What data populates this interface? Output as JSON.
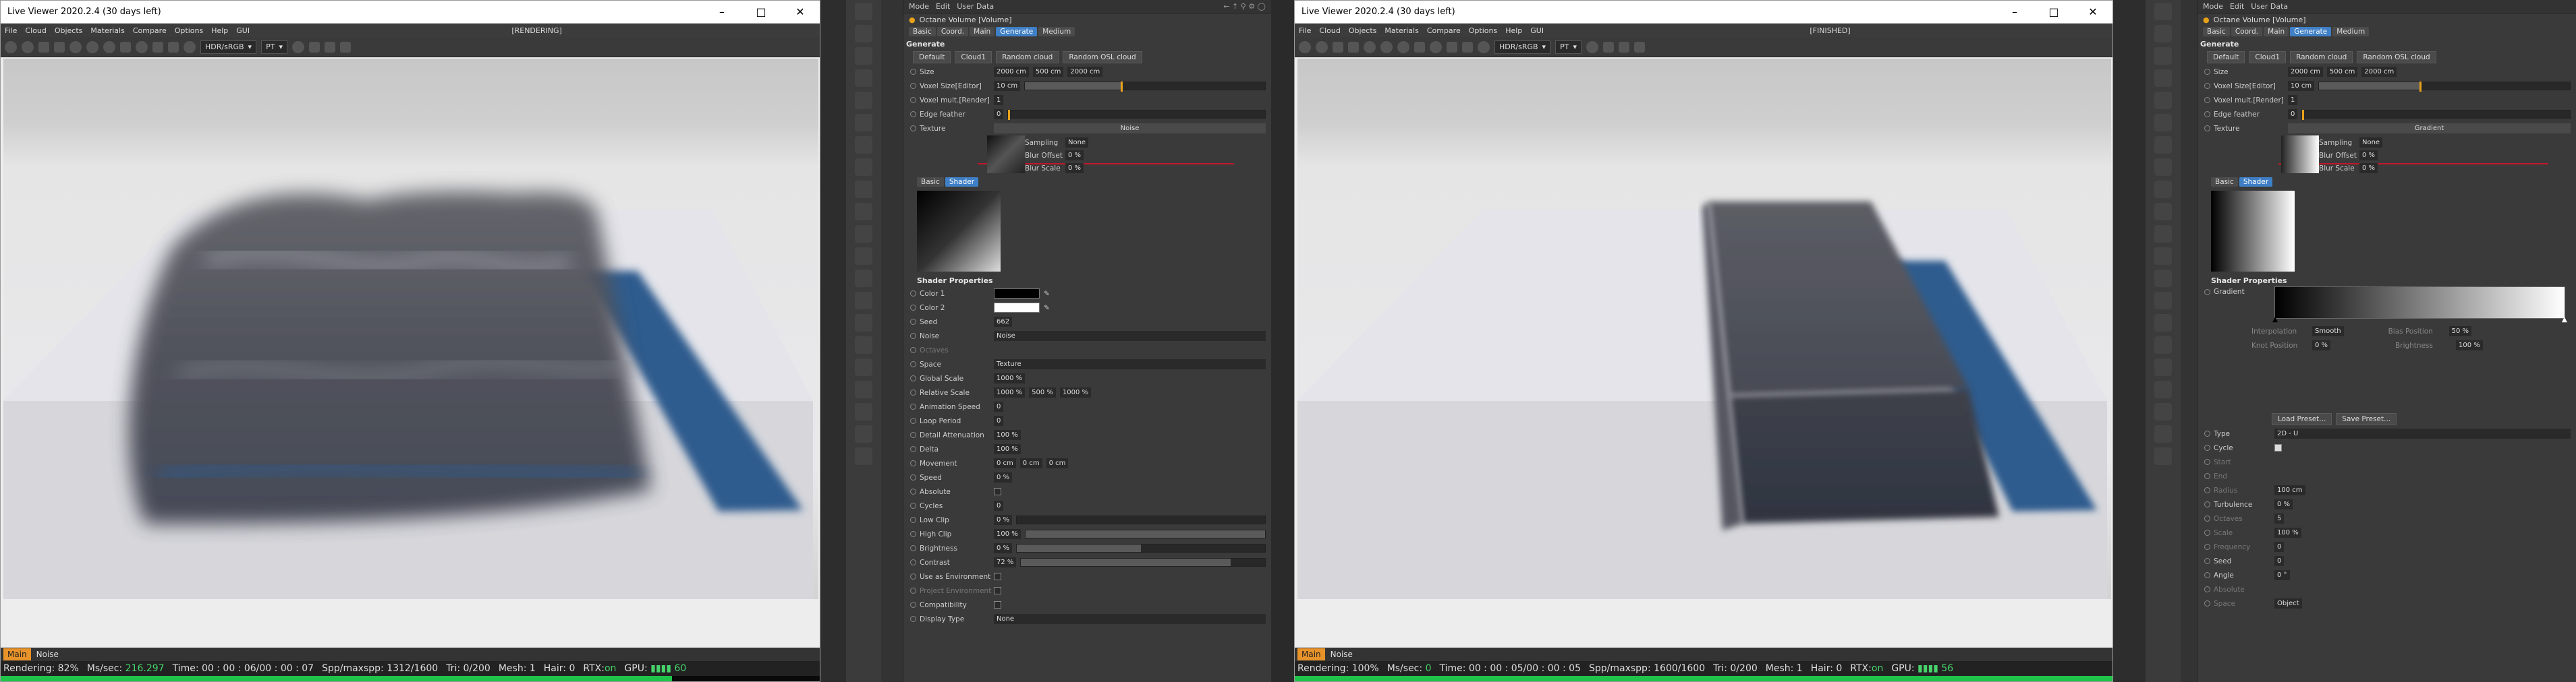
{
  "viewer1": {
    "title": "Live Viewer 2020.2.4 (30 days left)",
    "menu": [
      "File",
      "Cloud",
      "Objects",
      "Materials",
      "Compare",
      "Options",
      "Help",
      "GUI"
    ],
    "state": "[RENDERING]",
    "colorspace": "HDR/sRGB",
    "kernel": "PT",
    "tabs": [
      "Main",
      "Noise"
    ],
    "rendering": "Rendering: 82%",
    "mssec_label": "Ms/sec:",
    "mssec": "216.297",
    "time": "Time: 00 : 00 : 06/00 : 00 : 07",
    "spp_label": "Spp/maxspp:",
    "spp": "1312/1600",
    "tri": "Tri: 0/200",
    "mesh": "Mesh: 1",
    "hair": "Hair: 0",
    "rtx_label": "RTX:",
    "rtx": "on",
    "gpu_label": "GPU:",
    "gpu": "60",
    "progress": 0.82
  },
  "viewer2": {
    "title": "Live Viewer 2020.2.4 (30 days left)",
    "menu": [
      "File",
      "Cloud",
      "Objects",
      "Materials",
      "Compare",
      "Options",
      "Help",
      "GUI"
    ],
    "state": "[FINISHED]",
    "colorspace": "HDR/sRGB",
    "kernel": "PT",
    "tabs": [
      "Main",
      "Noise"
    ],
    "rendering": "Rendering: 100%",
    "mssec_label": "Ms/sec:",
    "mssec": "0",
    "time": "Time: 00 : 00 : 05/00 : 00 : 05",
    "spp_label": "Spp/maxspp:",
    "spp": "1600/1600",
    "tri": "Tri: 0/200",
    "mesh": "Mesh: 1",
    "hair": "Hair: 0",
    "rtx_label": "RTX:",
    "rtx": "on",
    "gpu_label": "GPU:",
    "gpu": "56",
    "progress": 1.0
  },
  "attr1": {
    "header": [
      "Mode",
      "Edit",
      "User Data"
    ],
    "object": "Octane Volume [Volume]",
    "tabs": [
      "Basic",
      "Coord.",
      "Main",
      "Generate",
      "Medium"
    ],
    "section": "Generate",
    "presets": [
      "Default",
      "Cloud1",
      "Random cloud",
      "Random OSL cloud"
    ],
    "size_label": "Size",
    "size": [
      "2000 cm",
      "500 cm",
      "2000 cm"
    ],
    "voxel_size_label": "Voxel Size[Editor]",
    "voxel_size": "10 cm",
    "voxel_mult_label": "Voxel mult.[Render]",
    "voxel_mult": "1",
    "edge_label": "Edge feather",
    "edge": "0",
    "texture_label": "Texture",
    "texture": "Noise",
    "sampling_label": "Sampling",
    "sampling": "None",
    "blur_offset_label": "Blur Offset",
    "blur_offset": "0 %",
    "blur_scale_label": "Blur Scale",
    "blur_scale": "0 %",
    "subtabs": [
      "Basic",
      "Shader"
    ],
    "shader_props": "Shader Properties",
    "color1_label": "Color 1",
    "color2_label": "Color 2",
    "seed_label": "Seed",
    "seed": "662",
    "noise_label": "Noise",
    "noise": "Noise",
    "octaves_label": "Octaves",
    "space_label": "Space",
    "space": "Texture",
    "global_scale_label": "Global Scale",
    "global_scale": "1000 %",
    "rel_scale_label": "Relative Scale",
    "rel_scale": [
      "1000 %",
      "500 %",
      "1000 %"
    ],
    "anim_speed_label": "Animation Speed",
    "anim_speed": "0",
    "loop_label": "Loop Period",
    "loop": "0",
    "detail_label": "Detail Attenuation",
    "detail": "100 %",
    "delta_label": "Delta",
    "delta": "100 %",
    "movement_label": "Movement",
    "movement": [
      "0 cm",
      "0 cm",
      "0 cm"
    ],
    "speed_label": "Speed",
    "speed": "0 %",
    "absolute_label": "Absolute",
    "cycles_label": "Cycles",
    "cycles": "0",
    "lowclip_label": "Low Clip",
    "lowclip": "0 %",
    "highclip_label": "High Clip",
    "highclip": "100 %",
    "brightness_label": "Brightness",
    "brightness": "0 %",
    "contrast_label": "Contrast",
    "contrast": "72 %",
    "use_env_label": "Use as Environment",
    "project_env_label": "Project Environment",
    "compat_label": "Compatibility",
    "display_label": "Display Type",
    "display": "None"
  },
  "attr2": {
    "header": [
      "Mode",
      "Edit",
      "User Data"
    ],
    "object": "Octane Volume [Volume]",
    "tabs": [
      "Basic",
      "Coord.",
      "Main",
      "Generate",
      "Medium"
    ],
    "section": "Generate",
    "presets": [
      "Default",
      "Cloud1",
      "Random cloud",
      "Random OSL cloud"
    ],
    "size_label": "Size",
    "size": [
      "2000 cm",
      "500 cm",
      "2000 cm"
    ],
    "voxel_size_label": "Voxel Size[Editor]",
    "voxel_size": "10 cm",
    "voxel_mult_label": "Voxel mult.[Render]",
    "voxel_mult": "1",
    "edge_label": "Edge feather",
    "edge": "0",
    "texture_label": "Texture",
    "texture": "Gradient",
    "sampling_label": "Sampling",
    "sampling": "None",
    "blur_offset_label": "Blur Offset",
    "blur_offset": "0 %",
    "blur_scale_label": "Blur Scale",
    "blur_scale": "0 %",
    "subtabs": [
      "Basic",
      "Shader"
    ],
    "shader_props": "Shader Properties",
    "gradient_label": "Gradient",
    "interp_label": "Interpolation",
    "interp": "Smooth",
    "knot_label": "Knot Position",
    "knot": "0 %",
    "bias_label": "Bias Position",
    "bias": "50 %",
    "bright_label": "Brightness",
    "bright": "100 %",
    "load_preset": "Load Preset...",
    "save_preset": "Save Preset...",
    "type_label": "Type",
    "type": "2D - U",
    "cycle_label": "Cycle",
    "start_label": "Start",
    "end_label": "End",
    "radius_label": "Radius",
    "radius": "100 cm",
    "turb_label": "Turbulence",
    "turb": "0 %",
    "octaves_label": "Octaves",
    "octaves": "5",
    "scale_label": "Scale",
    "scale": "100 %",
    "freq_label": "Frequency",
    "freq": "0",
    "seed_label": "Seed",
    "seed": "0",
    "angle_label": "Angle",
    "angle": "0 °",
    "absolute_label": "Absolute",
    "space_label": "Space",
    "space": "Object"
  },
  "colors": {
    "accent_orange": "#e8932a",
    "tab_blue": "#3f7fc6",
    "progress_green": "#1fc34a",
    "volume_blue": "#2f5c8e"
  }
}
